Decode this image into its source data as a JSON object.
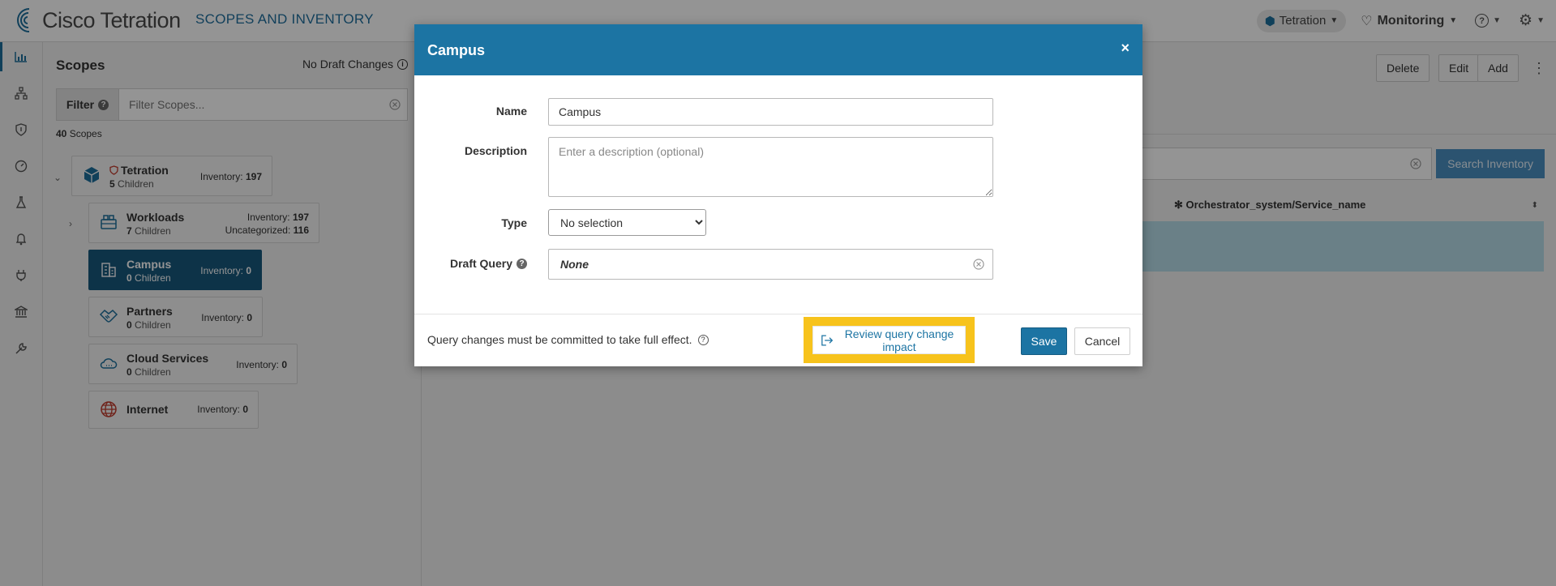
{
  "topbar": {
    "logo_text": "Cisco Tetration",
    "app_title": "SCOPES AND INVENTORY",
    "scope_selector": "Tetration",
    "monitoring_label": "Monitoring"
  },
  "scopes_panel": {
    "title": "Scopes",
    "draft_status": "No Draft Changes",
    "filter_label": "Filter",
    "filter_placeholder": "Filter Scopes...",
    "count_number": "40",
    "count_label": "Scopes",
    "root": {
      "name": "Tetration",
      "children_count": "5",
      "children_label": "Children",
      "inventory_label": "Inventory:",
      "inventory_value": "197"
    },
    "items": [
      {
        "name": "Workloads",
        "children_count": "7",
        "children_label": "Children",
        "inventory_label": "Inventory:",
        "inventory_value": "197",
        "uncategorized_label": "Uncategorized:",
        "uncategorized_value": "116"
      },
      {
        "name": "Campus",
        "children_count": "0",
        "children_label": "Children",
        "inventory_label": "Inventory:",
        "inventory_value": "0"
      },
      {
        "name": "Partners",
        "children_count": "0",
        "children_label": "Children",
        "inventory_label": "Inventory:",
        "inventory_value": "0"
      },
      {
        "name": "Cloud Services",
        "children_count": "0",
        "children_label": "Children",
        "inventory_label": "Inventory:",
        "inventory_value": "0"
      },
      {
        "name": "Internet",
        "inventory_label": "Inventory:",
        "inventory_value": "0"
      }
    ]
  },
  "main": {
    "delete_label": "Delete",
    "edit_label": "Edit",
    "add_label": "Add",
    "search_button": "Search Inventory",
    "column_header": "Orchestrator_system/Service_name"
  },
  "modal": {
    "title": "Campus",
    "close_glyph": "×",
    "name_label": "Name",
    "name_value": "Campus",
    "description_label": "Description",
    "description_placeholder": "Enter a description (optional)",
    "type_label": "Type",
    "type_selected": "No selection",
    "draft_query_label": "Draft Query",
    "draft_query_value": "None",
    "footer_note": "Query changes must be committed to take full effect.",
    "review_label": "Review query change impact",
    "save_label": "Save",
    "cancel_label": "Cancel"
  },
  "colors": {
    "accent": "#1c74a3",
    "active_scope": "#18587d",
    "highlight": "#f7c31c"
  }
}
